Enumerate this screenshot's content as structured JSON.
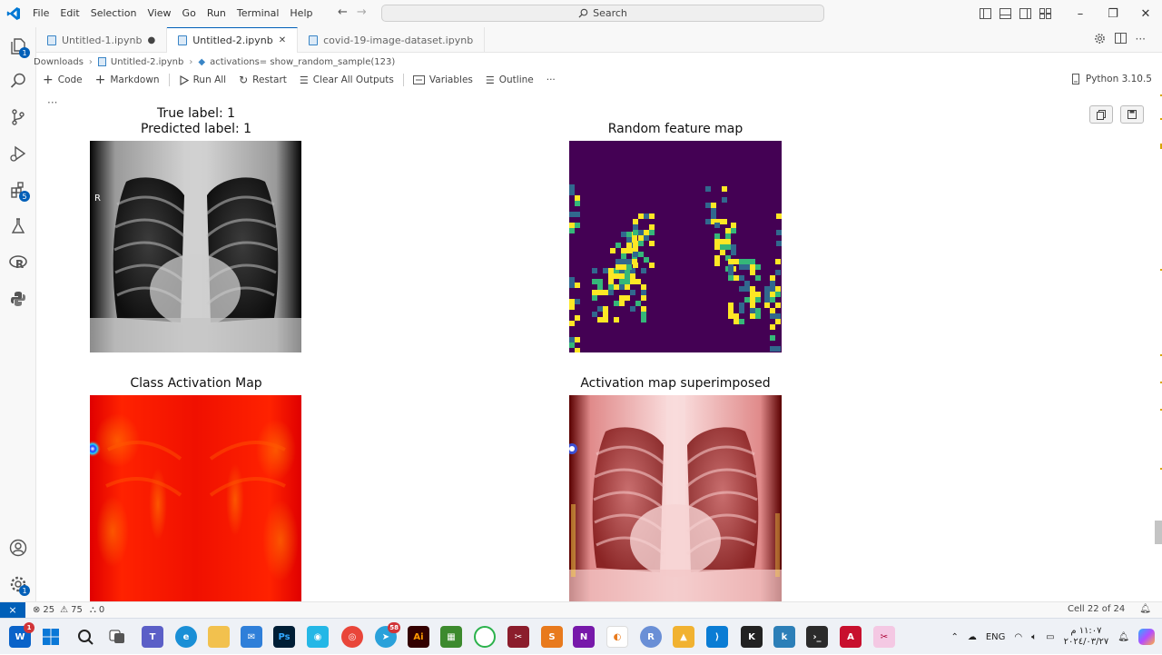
{
  "menu": [
    "File",
    "Edit",
    "Selection",
    "View",
    "Go",
    "Run",
    "Terminal",
    "Help"
  ],
  "search": {
    "label": "Search"
  },
  "tabs": [
    {
      "label": "Untitled-1.ipynb",
      "modified": "●"
    },
    {
      "label": "Untitled-2.ipynb",
      "close": "✕"
    },
    {
      "label": "covid-19-image-dataset.ipynb"
    }
  ],
  "breadcrumb": {
    "folder": "Downloads",
    "file": "Untitled-2.ipynb",
    "symbol": "activations= show_random_sample(123)"
  },
  "toolbar": {
    "code": "Code",
    "markdown": "Markdown",
    "run_all": "Run All",
    "restart": "Restart",
    "clear_outputs": "Clear All Outputs",
    "variables": "Variables",
    "outline": "Outline",
    "more": "···",
    "kernel": "Python 3.10.5"
  },
  "activity_badges": {
    "explorer": "1",
    "extensions": "5",
    "settings": "1"
  },
  "output": {
    "ellipsis": "···",
    "plots": [
      {
        "title_line1": "True label: 1",
        "title_line2": "Predicted label: 1",
        "marker": "R"
      },
      {
        "title": "Random feature map"
      },
      {
        "title": "Class Activation Map"
      },
      {
        "title": "Activation map superimposed"
      }
    ]
  },
  "status": {
    "errors": "25",
    "warnings": "75",
    "ports": "0",
    "cell": "Cell 22 of 24"
  },
  "taskbar": {
    "mail_badge": "1",
    "telegram_badge": "58",
    "lang": "ENG",
    "time": "١١:٠٧ م",
    "date": "٢٠٢٤/٠٣/٢٧"
  },
  "colors": {
    "accent": "#005fb8",
    "feature_bg": "#440154",
    "feature_yellow": "#fde725",
    "feature_green": "#35b779",
    "cam_red": "#ff1a00"
  }
}
